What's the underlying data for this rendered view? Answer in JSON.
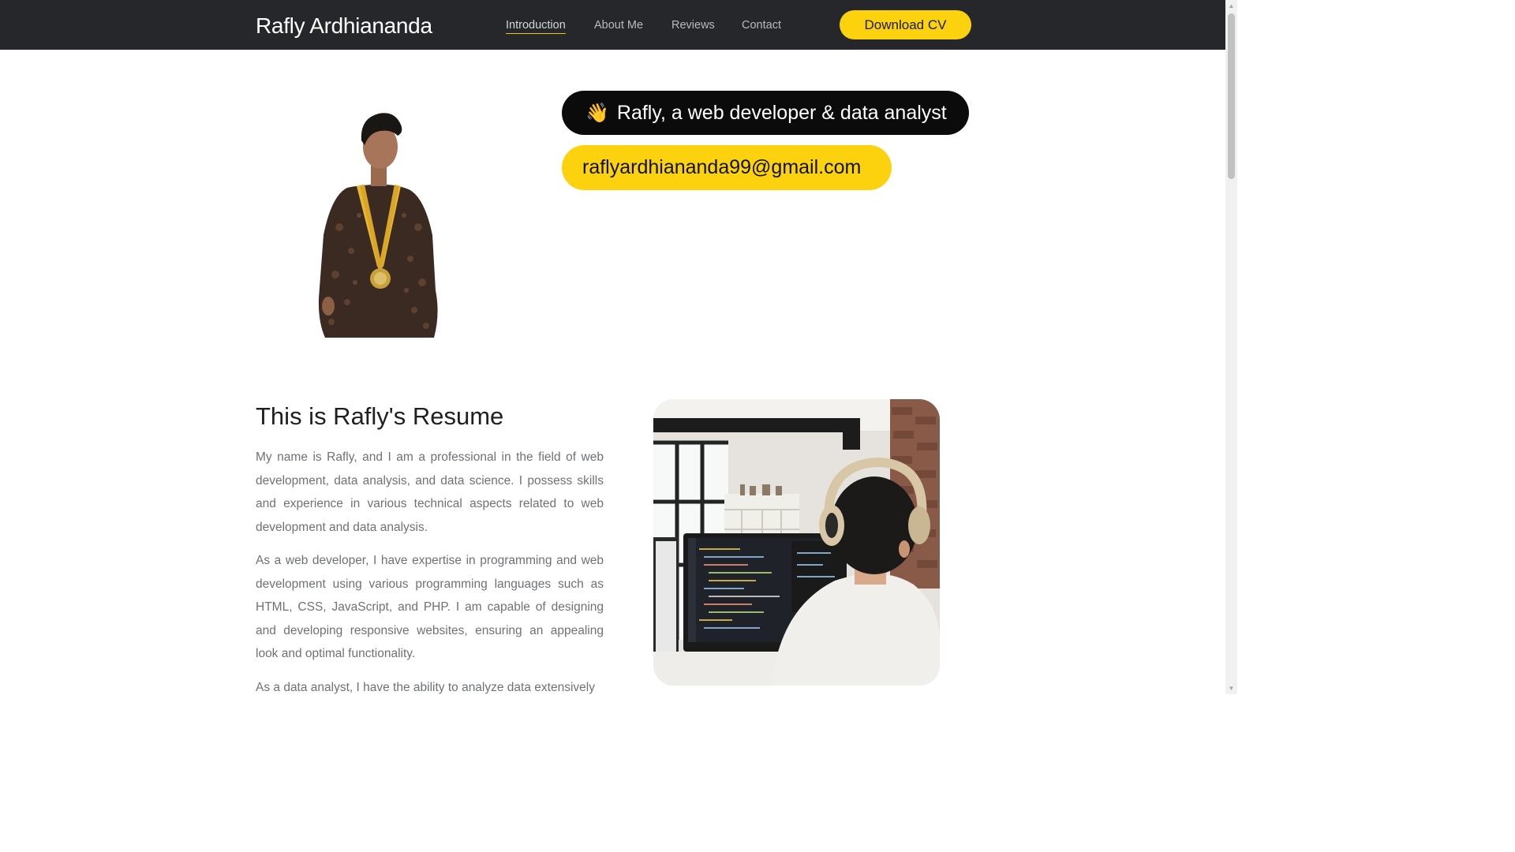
{
  "header": {
    "brand": "Rafly Ardhiananda",
    "nav": [
      {
        "label": "Introduction",
        "active": true
      },
      {
        "label": "About Me",
        "active": false
      },
      {
        "label": "Reviews",
        "active": false
      },
      {
        "label": "Contact",
        "active": false
      }
    ],
    "cta_label": "Download CV"
  },
  "hero": {
    "wave_emoji": "👋",
    "tagline": "Rafly, a web developer & data analyst",
    "email": "raflyardhiananda99@gmail.com"
  },
  "resume": {
    "title": "This is Rafly's Resume",
    "paragraphs": [
      "My name is Rafly, and I am a professional in the field of web development, data analysis, and data science. I possess skills and experience in various technical aspects related to web development and data analysis.",
      "As a web developer, I have expertise in programming and web development using various programming languages such as HTML, CSS, JavaScript, and PHP. I am capable of designing and developing responsive websites, ensuring an appealing look and optimal functionality.",
      "As a data analyst, I have the ability to analyze data extensively"
    ]
  },
  "colors": {
    "navbar_bg": "#25272a",
    "accent_yellow": "#fcd20e",
    "pill_dark": "#0b0b0b",
    "body_text": "#6e7176"
  },
  "icons": {
    "wave": "waving-hand-icon",
    "scroll_up": "scroll-up-arrow-icon",
    "scroll_down": "scroll-down-arrow-icon"
  }
}
